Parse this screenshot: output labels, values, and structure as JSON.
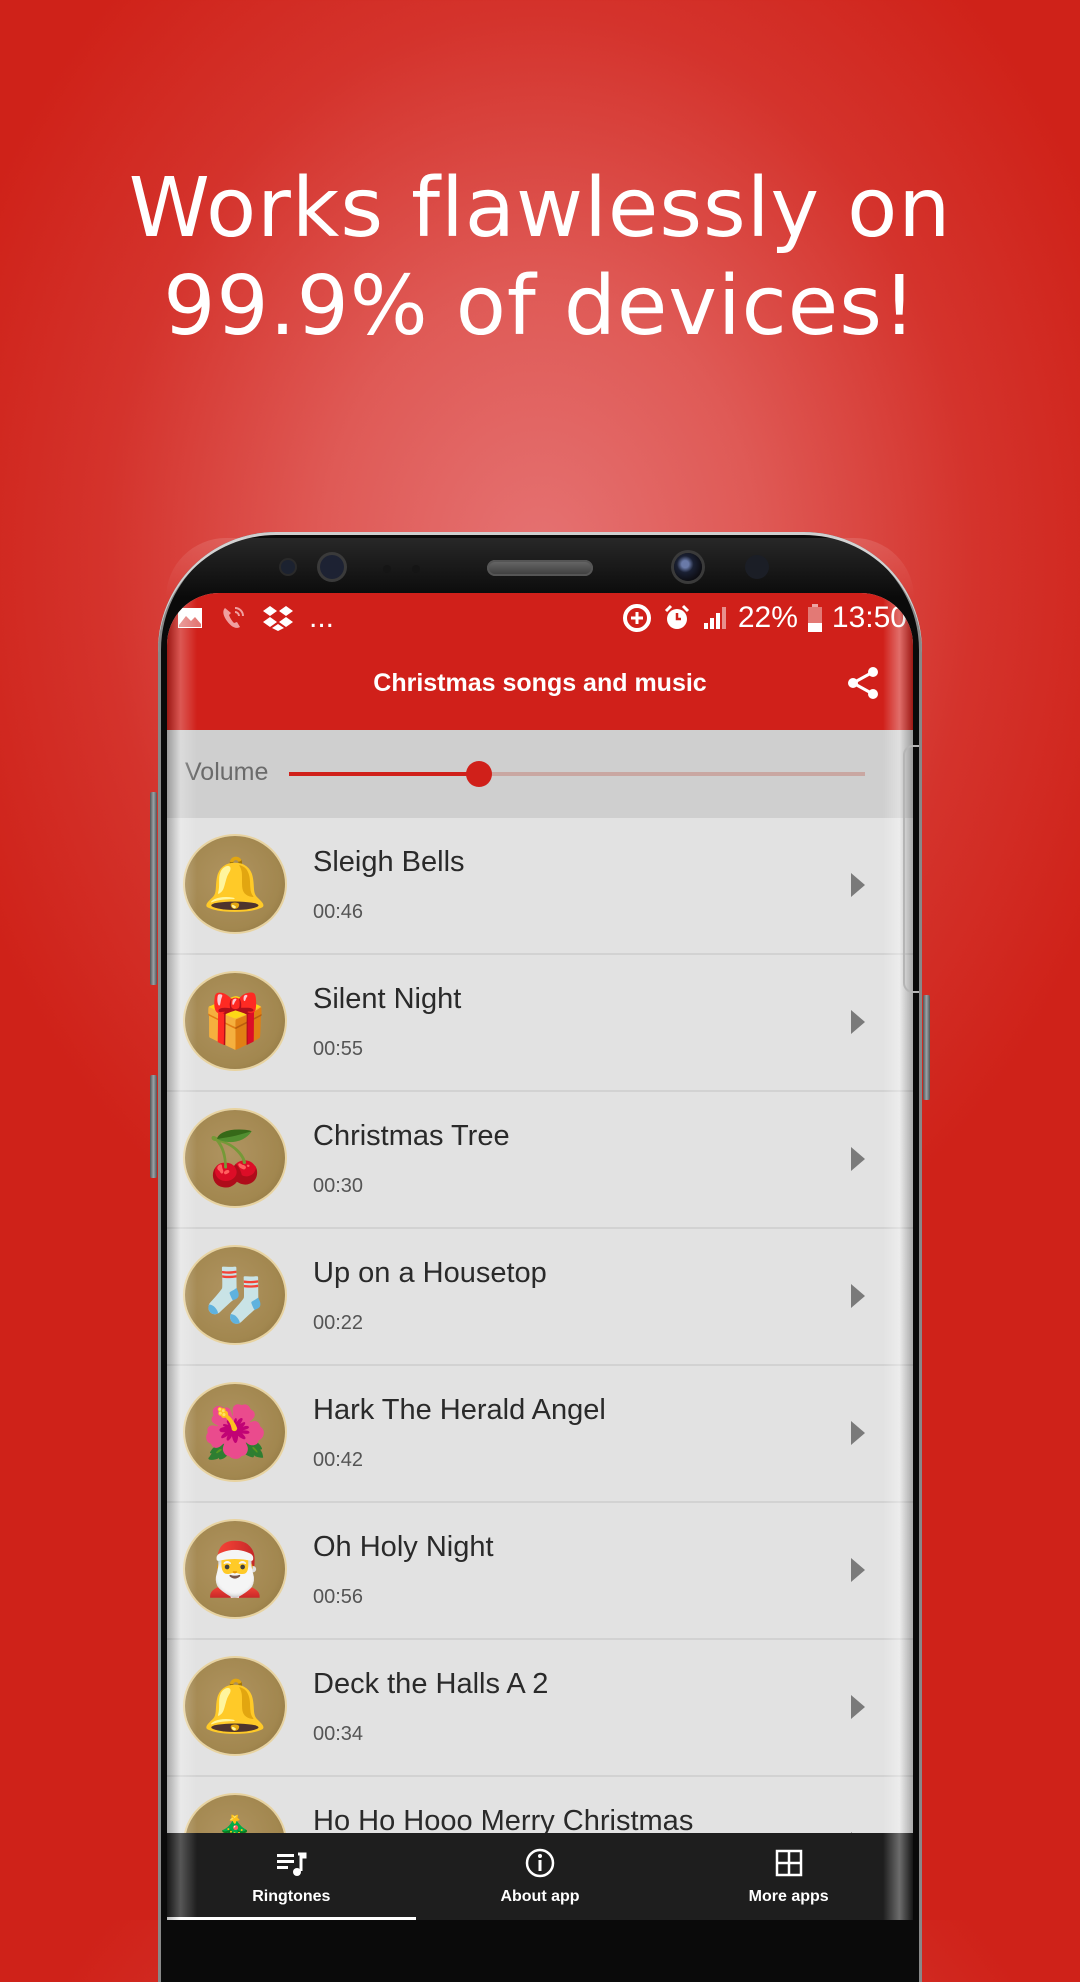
{
  "headline": {
    "line1": "Works flawlessly on",
    "line2": "99.9% of devices!"
  },
  "status_bar": {
    "left_icons": [
      "gallery-icon",
      "missed-call-icon",
      "dropbox-icon"
    ],
    "more": "...",
    "right_icons": [
      "data-saver-icon",
      "alarm-icon",
      "signal-icon"
    ],
    "battery": "22%",
    "time": "13:50"
  },
  "app_bar": {
    "title": "Christmas songs and music",
    "share_icon": "share-icon"
  },
  "volume": {
    "label": "Volume",
    "value": 0.33
  },
  "songs": [
    {
      "title": "Sleigh Bells",
      "duration": "00:46",
      "icon": "bells-icon",
      "glyph": "🔔"
    },
    {
      "title": "Silent Night",
      "duration": "00:55",
      "icon": "gift-sack-icon",
      "glyph": "🎁"
    },
    {
      "title": "Christmas Tree",
      "duration": "00:30",
      "icon": "holly-icon",
      "glyph": "🍒"
    },
    {
      "title": "Up on a Housetop",
      "duration": "00:22",
      "icon": "stocking-icon",
      "glyph": "🧦"
    },
    {
      "title": "Hark The Herald Angel",
      "duration": "00:42",
      "icon": "poinsettia-icon",
      "glyph": "🌺"
    },
    {
      "title": "Oh Holy Night",
      "duration": "00:56",
      "icon": "santa-icon",
      "glyph": "🎅"
    },
    {
      "title": "Deck the Halls A 2",
      "duration": "00:34",
      "icon": "bell-icon",
      "glyph": "🔔"
    },
    {
      "title": "Ho Ho Hooo Merry Christmas",
      "duration": "",
      "icon": "candy-cane-icon",
      "glyph": "🎄"
    }
  ],
  "bottom_nav": {
    "selected": 0,
    "items": [
      {
        "label": "Ringtones",
        "icon": "playlist-music-icon"
      },
      {
        "label": "About app",
        "icon": "info-icon"
      },
      {
        "label": "More apps",
        "icon": "grid-icon"
      }
    ]
  },
  "colors": {
    "brand_red": "#d0201a",
    "list_bg": "#e2e2e2",
    "nav_bg": "#1e1e1e"
  }
}
